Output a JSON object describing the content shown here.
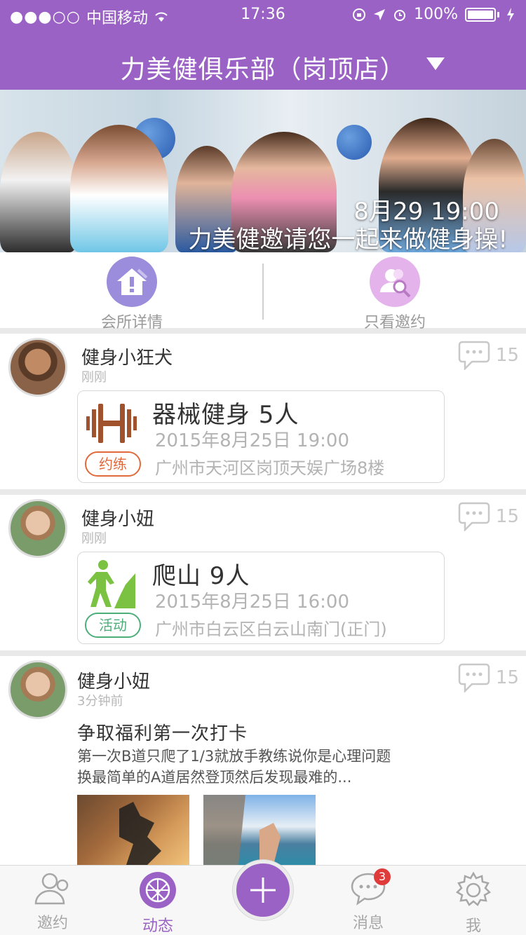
{
  "status_bar": {
    "carrier": "中国移动",
    "time": "17:36",
    "battery": "100%"
  },
  "header": {
    "title": "力美健俱乐部（岗顶店）"
  },
  "banner": {
    "line1": "8月29 19:00",
    "line2": "力美健邀请您一起来做健身操!"
  },
  "quick_menu": [
    {
      "label": "会所详情",
      "icon": "club-info-icon"
    },
    {
      "label": "只看邀约",
      "icon": "invites-only-icon"
    }
  ],
  "feed": [
    {
      "user": "健身小狂犬",
      "time": "刚刚",
      "comments": "15",
      "event": {
        "title": "器械健身 5人",
        "date": "2015年8月25日 19:00",
        "badge": "约练",
        "address": "广州市天河区岗顶天娱广场8楼",
        "color": "#e06a3b",
        "icon_color": "#a0522d"
      }
    },
    {
      "user": "健身小妞",
      "time": "刚刚",
      "comments": "15",
      "event": {
        "title": "爬山 9人",
        "date": "2015年8月25日 16:00",
        "badge": "活动",
        "address": "广州市白云区白云山南门(正门)",
        "color": "#4caf79",
        "icon_color": "#7cc242"
      }
    },
    {
      "user": "健身小妞",
      "time": "3分钟前",
      "comments": "15",
      "post": {
        "title": "争取福利第一次打卡",
        "body_line1": "第一次B道只爬了1/3就放手教练说你是心理问题",
        "body_line2": "换最简单的A道居然登顶然后发现最难的..."
      }
    }
  ],
  "tabbar": {
    "items": [
      {
        "label": "邀约",
        "icon": "invite-icon"
      },
      {
        "label": "动态",
        "icon": "feed-icon"
      },
      {
        "label": "",
        "icon": "add-icon"
      },
      {
        "label": "消息",
        "icon": "message-icon",
        "badge": "3"
      },
      {
        "label": "我",
        "icon": "settings-icon"
      }
    ]
  },
  "colors": {
    "brand": "#9b62c5"
  }
}
